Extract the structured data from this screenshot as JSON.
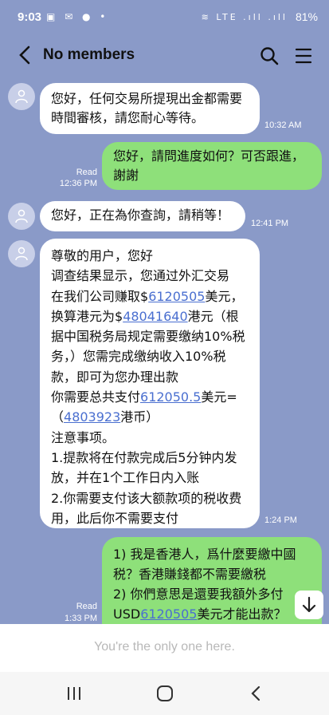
{
  "status": {
    "time": "9:03",
    "notif_icons": "▣ ✉ ● •",
    "signal_icons": "≋ LTE .ıll .ıll",
    "battery": "81%"
  },
  "header": {
    "title": "No members"
  },
  "messages": [
    {
      "dir": "in",
      "lines": [
        "您好，任何交易所提現出金都需要",
        "時間審核，請您耐心等待。"
      ],
      "time": "10:32 AM"
    },
    {
      "dir": "out",
      "lines": [
        "您好，請問進度如何？可否跟進，",
        "謝謝"
      ],
      "read": "Read",
      "time": "12:36 PM"
    },
    {
      "dir": "in",
      "lines": [
        "您好，正在為你查詢，請稍等！"
      ],
      "time": "12:41 PM"
    },
    {
      "dir": "in",
      "l1": "尊敬的用户，您好",
      "l2": "调查结果显示，您通过外汇交易",
      "l3a": "在我们公司赚取$",
      "l3link": "6120505",
      "l3b": "美元，",
      "l4a": "换算港元为$",
      "l4link": "48041640",
      "l4b": "港元（根",
      "l5": "据中国税务局规定需要缴纳10%税",
      "l6": "务，）您需完成缴纳收入10%税",
      "l7": "款，即可为您办理出款",
      "l8a": "你需要总共支付",
      "l8link": "612050.5",
      "l8b": "美元=",
      "l9a": "（",
      "l9link": "4803923",
      "l9b": "港币）",
      "l10": "注意事项。",
      "l11": "1.提款将在付款完成后5分钟内发",
      "l12": "放，并在1个工作日内入账",
      "l13": "2.你需要支付该大额款项的税收费",
      "l14": "用，此后你不需要支付",
      "time": "1:24 PM"
    },
    {
      "dir": "out",
      "l1": "1) 我是香港人，爲什麼要繳中國",
      "l2": "税？香港賺錢都不需要繳税",
      "l3": "2) 你們意思是還要我額外多付",
      "l4a": "USD",
      "l4link": "6120505",
      "l4b": "美元才能出款？",
      "read": "Read",
      "time": "1:33 PM"
    }
  ],
  "footer": {
    "text": "You're the only one here."
  }
}
